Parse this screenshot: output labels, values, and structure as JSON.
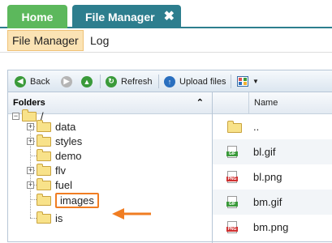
{
  "tabs": {
    "home_label": "Home",
    "file_manager_label": "File Manager",
    "close_glyph": "✖"
  },
  "subnav": {
    "items": [
      {
        "label": "File Manager",
        "active": true
      },
      {
        "label": "Log",
        "active": false
      }
    ]
  },
  "toolbar": {
    "back_label": "Back",
    "refresh_label": "Refresh",
    "upload_label": "Upload files",
    "view_dropdown_glyph": "▼"
  },
  "folders": {
    "title": "Folders",
    "collapse_glyph": "⌃",
    "root": "/",
    "children": [
      "data",
      "styles",
      "demo",
      "flv",
      "fuel",
      "images",
      "is"
    ],
    "expandable": [
      true,
      true,
      false,
      false,
      true,
      false,
      false
    ],
    "highlighted": "images"
  },
  "files": {
    "column_name": "Name",
    "rows": [
      {
        "name": "..",
        "icon": "folder-icon"
      },
      {
        "name": "bl.gif",
        "icon": "gif-file-icon"
      },
      {
        "name": "bl.png",
        "icon": "png-file-icon"
      },
      {
        "name": "bm.gif",
        "icon": "gif-file-icon"
      },
      {
        "name": "bm.png",
        "icon": "png-file-icon"
      }
    ]
  },
  "colors": {
    "home_tab": "#5cb85c",
    "active_tab": "#2d7e8e",
    "highlight": "#f07d22",
    "subnav_active_bg": "#fbe3b4"
  }
}
